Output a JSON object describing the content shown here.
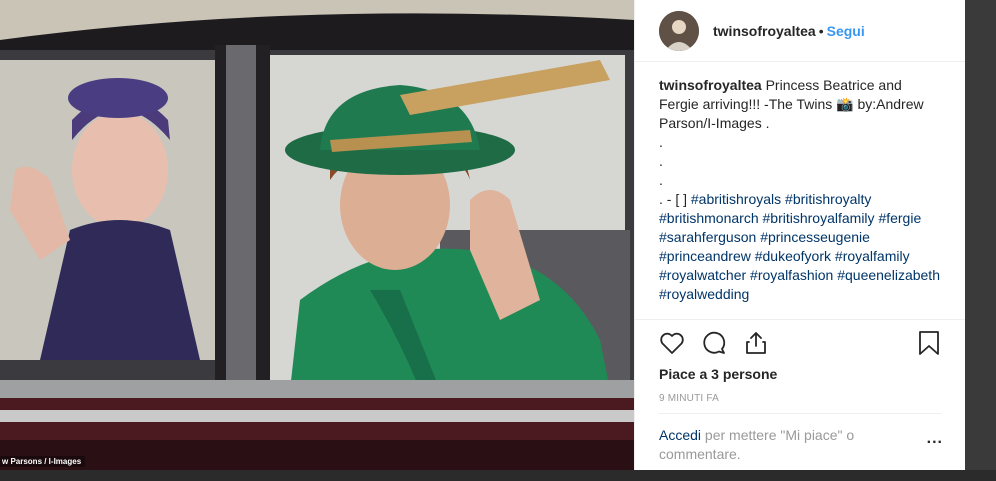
{
  "post": {
    "username": "twinsofroyaltea",
    "separator": "•",
    "follow_label": "Segui",
    "caption": {
      "username": "twinsofroyaltea",
      "text": " Princess Beatrice and Fergie arriving!!! -The Twins 📸 by:Andrew Parson/I-Images .",
      "dot_lines": [
        ".",
        ".",
        "."
      ],
      "prefix": ". - [ ] ",
      "hashtags": [
        "#abritishroyals",
        "#britishroyalty",
        "#britishmonarch",
        "#britishroyalfamily",
        "#fergie",
        "#sarahferguson",
        "#princesseugenie",
        "#princeandrew",
        "#dukeofyork",
        "#royalfamily",
        "#royalwatcher",
        "#royalfashion",
        "#queenelizabeth",
        "#royalwedding"
      ]
    },
    "likes_text": "Piace a 3 persone",
    "time_text": "9 MINUTI FA",
    "login_link": "Accedi",
    "login_text": " per mettere \"Mi piace\" o commentare.",
    "more_label": "..."
  },
  "photo": {
    "credit": "w Parsons / I-Images"
  },
  "icons": {
    "like": "heart-icon",
    "comment": "comment-icon",
    "share": "share-icon",
    "save": "bookmark-icon",
    "more": "more-options-icon"
  },
  "colors": {
    "link_blue": "#3897f0",
    "hashtag": "#003569",
    "text": "#262626",
    "muted": "#999999",
    "coat_green": "#1f8a55"
  }
}
